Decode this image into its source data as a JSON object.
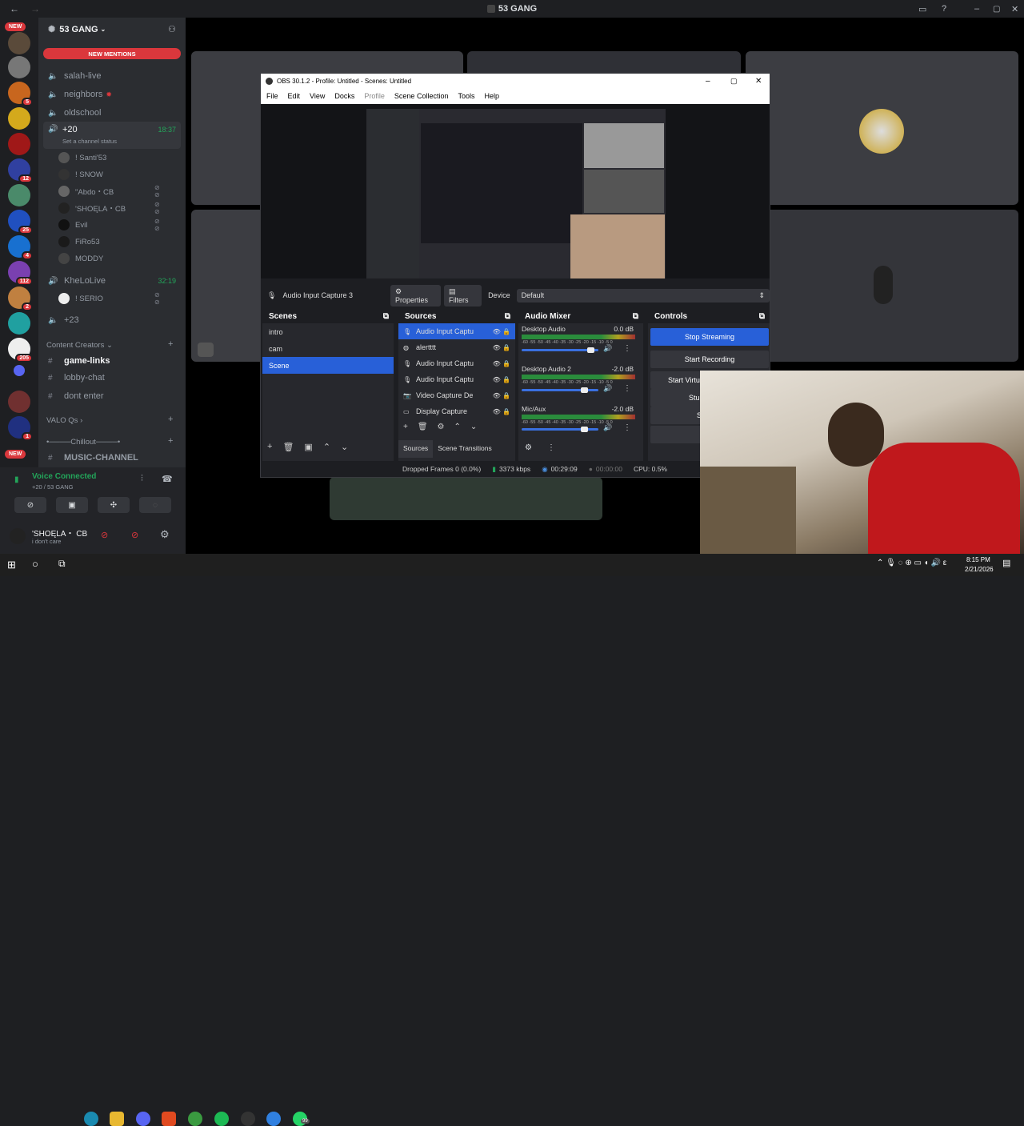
{
  "window": {
    "title": "53 GANG"
  },
  "servers": {
    "new_top": "NEW",
    "new_bottom": "NEW",
    "badges": [
      "5",
      "12",
      "25",
      "4",
      "112",
      "2",
      "205",
      "1"
    ]
  },
  "sidebar": {
    "server_name": "53 GANG",
    "new_mentions": "NEW MENTIONS",
    "channels": [
      {
        "name": "salah-live"
      },
      {
        "name": "neighbors"
      },
      {
        "name": "oldschool"
      }
    ],
    "voice_20": {
      "name": "+20",
      "time": "18:37",
      "status": "Set a channel status"
    },
    "voice_users": [
      "! Santi'53",
      "! SNOW",
      "\"Abdo・CB",
      "'SHOĘLA・CB",
      "Evil",
      "FiRo53",
      "MODDY"
    ],
    "khelolive": {
      "name": "KheLoLive",
      "time": "32:19",
      "user": "! SERIO"
    },
    "voice_23": "+23",
    "category1": "Content Creators",
    "text_channels": [
      "game-links",
      "lobby-chat",
      "dont enter"
    ],
    "category2": "VALO Qs",
    "category3": "•────Chillout────•",
    "music": "MUSIC-CHANNEL"
  },
  "voice": {
    "status": "Voice Connected",
    "channel": "+20 / 53 GANG"
  },
  "user": {
    "name": "'SHOĘLA・ CB",
    "status": "i don't care"
  },
  "obs": {
    "title": "OBS 30.1.2 - Profile: Untitled - Scenes: Untitled",
    "menu": [
      "File",
      "Edit",
      "View",
      "Docks",
      "Profile",
      "Scene Collection",
      "Tools",
      "Help"
    ],
    "source_label": "Audio Input Capture 3",
    "properties": "Properties",
    "filters": "Filters",
    "device_label": "Device",
    "device_value": "Default",
    "scenes_title": "Scenes",
    "scenes": [
      "intro",
      "cam",
      "Scene"
    ],
    "sources_title": "Sources",
    "sources": [
      "Audio Input Captu",
      "alertttt",
      "Audio Input Captu",
      "Audio Input Captu",
      "Video Capture De",
      "Display Capture"
    ],
    "tab_sources": "Sources",
    "tab_transitions": "Scene Transitions",
    "mixer_title": "Audio Mixer",
    "mixer": [
      {
        "name": "Desktop Audio",
        "db": "0.0 dB",
        "level": 0.92
      },
      {
        "name": "Desktop Audio 2",
        "db": "-2.0 dB",
        "level": 0.85
      },
      {
        "name": "Mic/Aux",
        "db": "-2.0 dB",
        "level": 0.85
      }
    ],
    "mixer_scale": "-60 -55 -50 -45 -40 -35 -30 -25 -20 -15 -10 -5 0",
    "controls_title": "Controls",
    "controls": [
      "Stop Streaming",
      "Start Recording",
      "Start Virtu",
      "Stu",
      "S"
    ],
    "status": {
      "dropped": "Dropped Frames 0 (0.0%)",
      "kbps": "3373 kbps",
      "time1": "00:29:09",
      "time2": "00:00:00",
      "cpu": "CPU: 0.5%"
    }
  },
  "taskbar": {
    "time": "8:15 PM",
    "date": "2/21/2026",
    "wa_badge": "99"
  }
}
